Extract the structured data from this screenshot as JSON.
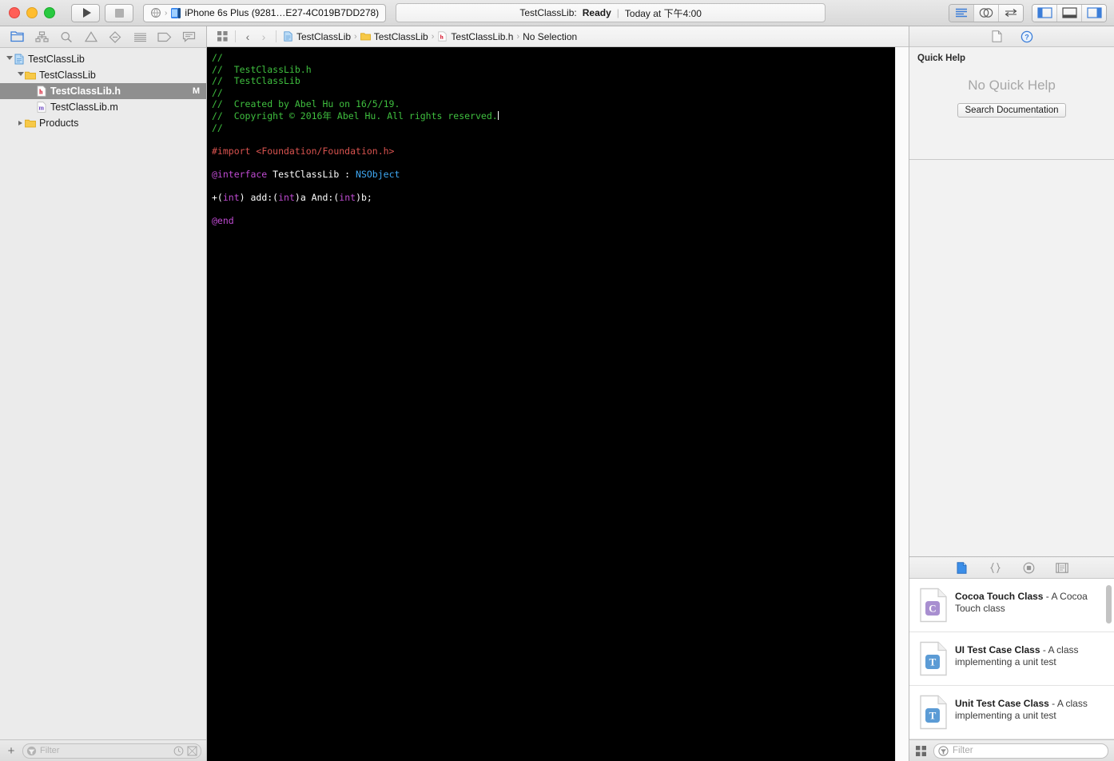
{
  "toolbar": {
    "run_label": "Run",
    "stop_label": "Stop",
    "scheme_name": "TestClassLib",
    "device_name": "iPhone 6s Plus (9281…E27-4C019B7DD278)",
    "status_project": "TestClassLib:",
    "status_state": "Ready",
    "status_divider": "|",
    "status_time": "Today at 下午4:00",
    "editor_standard_icon": "standard-editor-icon",
    "editor_assistant_icon": "assistant-editor-icon",
    "editor_version_icon": "version-editor-icon",
    "view_navigator_icon": "toggle-navigator-icon",
    "view_debug_icon": "toggle-debug-area-icon",
    "view_utilities_icon": "toggle-utilities-icon"
  },
  "navigator": {
    "tabs": [
      {
        "name": "project-navigator",
        "icon": "folder-icon",
        "selected": true
      },
      {
        "name": "source-control-navigator",
        "icon": "source-control-icon",
        "selected": false
      },
      {
        "name": "symbol-navigator",
        "icon": "search-icon",
        "selected": false
      },
      {
        "name": "issue-navigator",
        "icon": "warning-triangle-icon",
        "selected": false
      },
      {
        "name": "test-navigator",
        "icon": "test-diamond-icon",
        "selected": false
      },
      {
        "name": "debug-navigator",
        "icon": "debug-list-icon",
        "selected": false
      },
      {
        "name": "breakpoint-navigator",
        "icon": "breakpoint-tag-icon",
        "selected": false
      },
      {
        "name": "report-navigator",
        "icon": "report-speech-icon",
        "selected": false
      }
    ],
    "tree": [
      {
        "label": "TestClassLib",
        "icon": "project-icon",
        "depth": 0,
        "twisty": "open",
        "selected": false,
        "badge": ""
      },
      {
        "label": "TestClassLib",
        "icon": "folder-icon",
        "depth": 1,
        "twisty": "open",
        "selected": false,
        "badge": ""
      },
      {
        "label": "TestClassLib.h",
        "icon": "header-file-icon",
        "depth": 2,
        "twisty": "none",
        "selected": true,
        "badge": "M"
      },
      {
        "label": "TestClassLib.m",
        "icon": "source-file-icon",
        "depth": 2,
        "twisty": "none",
        "selected": false,
        "badge": ""
      },
      {
        "label": "Products",
        "icon": "folder-icon",
        "depth": 1,
        "twisty": "closed",
        "selected": false,
        "badge": ""
      }
    ],
    "footer": {
      "add_label": "+",
      "filter_placeholder": "Filter",
      "recent_icon": "clock-icon",
      "sourcecontrol_icon": "scm-filter-icon"
    }
  },
  "jumpbar": {
    "related_items_icon": "related-items-icon",
    "back_arrow": "‹",
    "forward_arrow": "›",
    "crumbs": [
      {
        "label": "TestClassLib",
        "icon": "project-icon"
      },
      {
        "label": "TestClassLib",
        "icon": "folder-icon"
      },
      {
        "label": "TestClassLib.h",
        "icon": "header-file-icon"
      },
      {
        "label": "No Selection",
        "icon": "none"
      }
    ]
  },
  "editor": {
    "filename": "TestClassLib.h",
    "code_lines": [
      [
        {
          "t": "//",
          "c": "cm"
        }
      ],
      [
        {
          "t": "//  TestClassLib.h",
          "c": "cm"
        }
      ],
      [
        {
          "t": "//  TestClassLib",
          "c": "cm"
        }
      ],
      [
        {
          "t": "//",
          "c": "cm"
        }
      ],
      [
        {
          "t": "//  Created by Abel Hu on 16/5/19.",
          "c": "cm"
        }
      ],
      [
        {
          "t": "//  Copyright © 2016年 Abel Hu. All rights reserved.",
          "c": "cm"
        },
        {
          "t": "",
          "c": "cursor"
        }
      ],
      [
        {
          "t": "//",
          "c": "cm"
        }
      ],
      [
        {
          "t": "",
          "c": "pl"
        }
      ],
      [
        {
          "t": "#import ",
          "c": "pp"
        },
        {
          "t": "<Foundation/Foundation.h>",
          "c": "pp"
        }
      ],
      [
        {
          "t": "",
          "c": "pl"
        }
      ],
      [
        {
          "t": "@interface",
          "c": "kw"
        },
        {
          "t": " TestClassLib : ",
          "c": "pl"
        },
        {
          "t": "NSObject",
          "c": "ty"
        }
      ],
      [
        {
          "t": "",
          "c": "pl"
        }
      ],
      [
        {
          "t": "+(",
          "c": "pl"
        },
        {
          "t": "int",
          "c": "kw"
        },
        {
          "t": ") add:(",
          "c": "pl"
        },
        {
          "t": "int",
          "c": "kw"
        },
        {
          "t": ")a And:(",
          "c": "pl"
        },
        {
          "t": "int",
          "c": "kw"
        },
        {
          "t": ")b;",
          "c": "pl"
        }
      ],
      [
        {
          "t": "",
          "c": "pl"
        }
      ],
      [
        {
          "t": "@end",
          "c": "kw"
        }
      ]
    ],
    "colors": {
      "background": "#000000",
      "comment": "#3fbf3f",
      "preprocessor": "#d9534f",
      "keyword": "#c04bd3",
      "type": "#3fa9f5",
      "plain": "#ffffff"
    }
  },
  "inspector": {
    "tabs": [
      {
        "name": "file-inspector",
        "icon": "document-icon",
        "selected": false
      },
      {
        "name": "quick-help-inspector",
        "icon": "question-circle-icon",
        "selected": true
      }
    ],
    "quick_help": {
      "title": "Quick Help",
      "empty_message": "No Quick Help",
      "search_button": "Search Documentation"
    }
  },
  "library": {
    "tabs": [
      {
        "name": "file-template-library",
        "icon": "document-icon",
        "selected": true
      },
      {
        "name": "code-snippet-library",
        "icon": "braces-icon",
        "selected": false
      },
      {
        "name": "object-library",
        "icon": "object-circle-icon",
        "selected": false
      },
      {
        "name": "media-library",
        "icon": "media-film-icon",
        "selected": false
      }
    ],
    "items": [
      {
        "title": "Cocoa Touch Class",
        "desc": "- A Cocoa Touch class",
        "badge": "C",
        "badge_color": "#a88fd0"
      },
      {
        "title": "UI Test Case Class",
        "desc": "- A class implementing a unit test",
        "badge": "T",
        "badge_color": "#5b9bd5"
      },
      {
        "title": "Unit Test Case Class",
        "desc": "- A class implementing a unit test",
        "badge": "T",
        "badge_color": "#5b9bd5"
      }
    ],
    "footer": {
      "grid_icon": "grid-view-icon",
      "filter_placeholder": "Filter",
      "filter_icon": "filter-circle-icon"
    }
  }
}
